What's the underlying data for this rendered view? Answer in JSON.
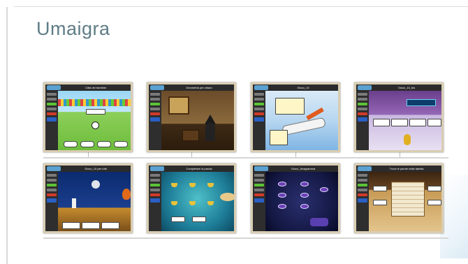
{
  "slide": {
    "title": "Umaigra"
  },
  "thumbnails": [
    {
      "title": "Città dei bambini",
      "theme": "football-stadium"
    },
    {
      "title": "Geometria per chiaro",
      "theme": "wizard-room"
    },
    {
      "title": "Gioco_10",
      "theme": "airplane-sky"
    },
    {
      "title": "Gioco_10_bis",
      "theme": "purple-stage"
    },
    {
      "title": "Gioco_10 per tutti",
      "theme": "night-moon"
    },
    {
      "title": "Completare la parola",
      "theme": "underwater"
    },
    {
      "title": "Gioco_Anagramma",
      "theme": "purple-space"
    },
    {
      "title": "Trova le parole nella tabella",
      "theme": "wooden-wordsearch"
    }
  ],
  "colors": {
    "title": "#5e7c86",
    "thumb_border": "#d9cdb2",
    "rule": "#d6d6d6"
  }
}
